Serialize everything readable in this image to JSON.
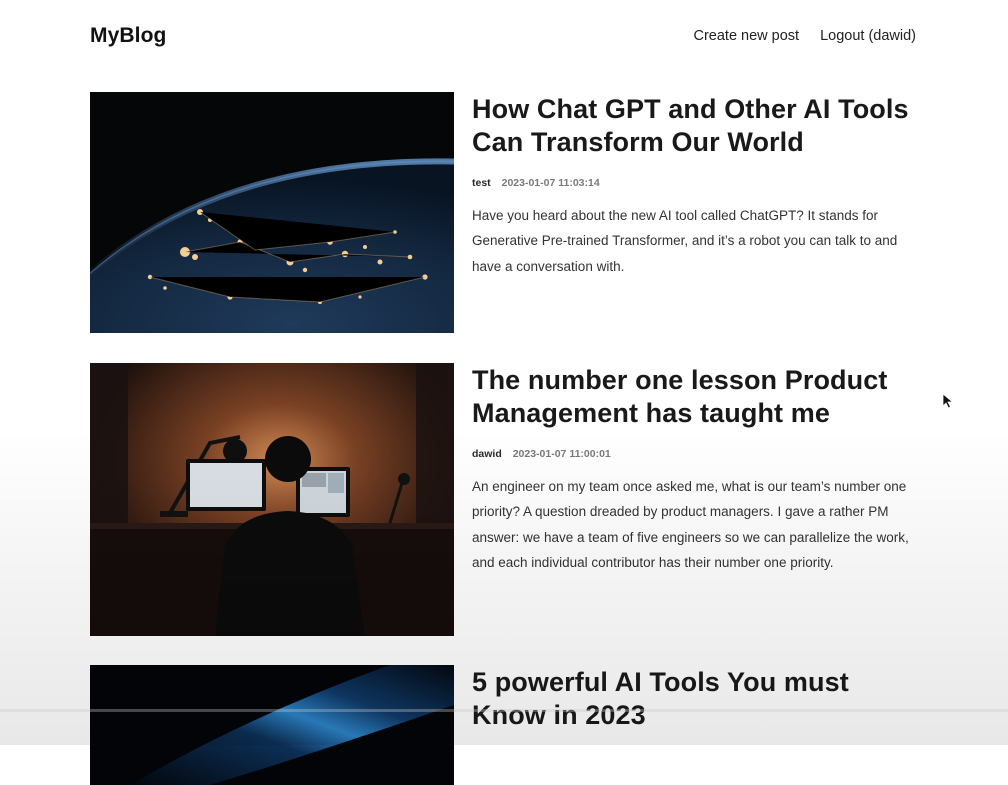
{
  "header": {
    "brand": "MyBlog",
    "nav": {
      "create_post": "Create new post",
      "logout": "Logout (dawid)"
    }
  },
  "posts": [
    {
      "title": "How Chat GPT and Other AI Tools Can Transform Our World",
      "author": "test",
      "date": "2023-01-07 11:03:14",
      "excerpt": "Have you heard about the new AI tool called ChatGPT? It stands for Generative Pre-trained Transformer, and it’s a robot you can talk to and have a conversation with.",
      "image": "earth-at-night-image"
    },
    {
      "title": "The number one lesson Product Management has taught me",
      "author": "dawid",
      "date": "2023-01-07 11:00:01",
      "excerpt": "An engineer on my team once asked me, what is our team’s number one priority? A question dreaded by product managers. I gave a rather PM answer: we have a team of five engineers so we can parallelize the work, and each individual contributor has their number one priority.",
      "image": "person-at-desk-image"
    },
    {
      "title": "5 powerful AI Tools You must Know in 2023",
      "image": "abstract-blue-light-image"
    }
  ],
  "colors": {
    "text": "#1f1f1f",
    "muted": "#7a7a7a",
    "background": "#ffffff"
  }
}
